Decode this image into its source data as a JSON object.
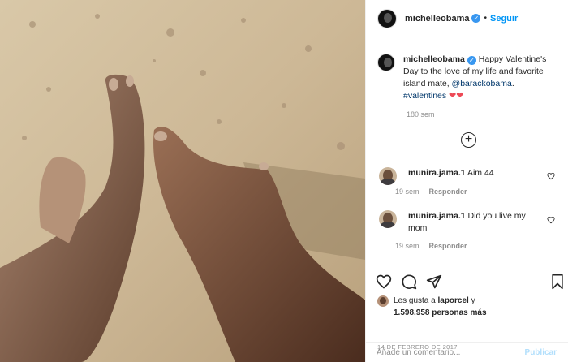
{
  "post_author": {
    "username": "michelleobama",
    "verified_label": "✓",
    "separator": "•",
    "follow_label": "Seguir"
  },
  "caption": {
    "username": "michelleobama",
    "text_before": " Happy Valentine's Day to the love of my life and favorite island mate, ",
    "mention": "@barackobama",
    "text_after": ".",
    "hashtag": "#valentines",
    "emoji": "❤❤",
    "time": "180 sem"
  },
  "comments": [
    {
      "username": "munira.jama.1",
      "text": " Aim 44",
      "time": "19 sem",
      "reply_label": "Responder"
    },
    {
      "username": "munira.jama.1",
      "text": " Did you live my mom",
      "time": "19 sem",
      "reply_label": "Responder"
    }
  ],
  "likes": {
    "prefix": "Les gusta a ",
    "user": "laporcel",
    "conjunction": " y",
    "count": "1.598.958",
    "suffix": " personas más"
  },
  "date": "14 DE FEBRERO DE 2017",
  "comment_box": {
    "placeholder": "Añade un comentario...",
    "publish_label": "Publicar"
  },
  "icons": [
    "plus-circle-icon",
    "heart-icon",
    "comment-icon",
    "share-icon",
    "bookmark-icon"
  ],
  "colors": {
    "link": "#00376b",
    "follow": "#0095f6",
    "secondary": "#8e8e8e",
    "heart": "#ed4956"
  }
}
